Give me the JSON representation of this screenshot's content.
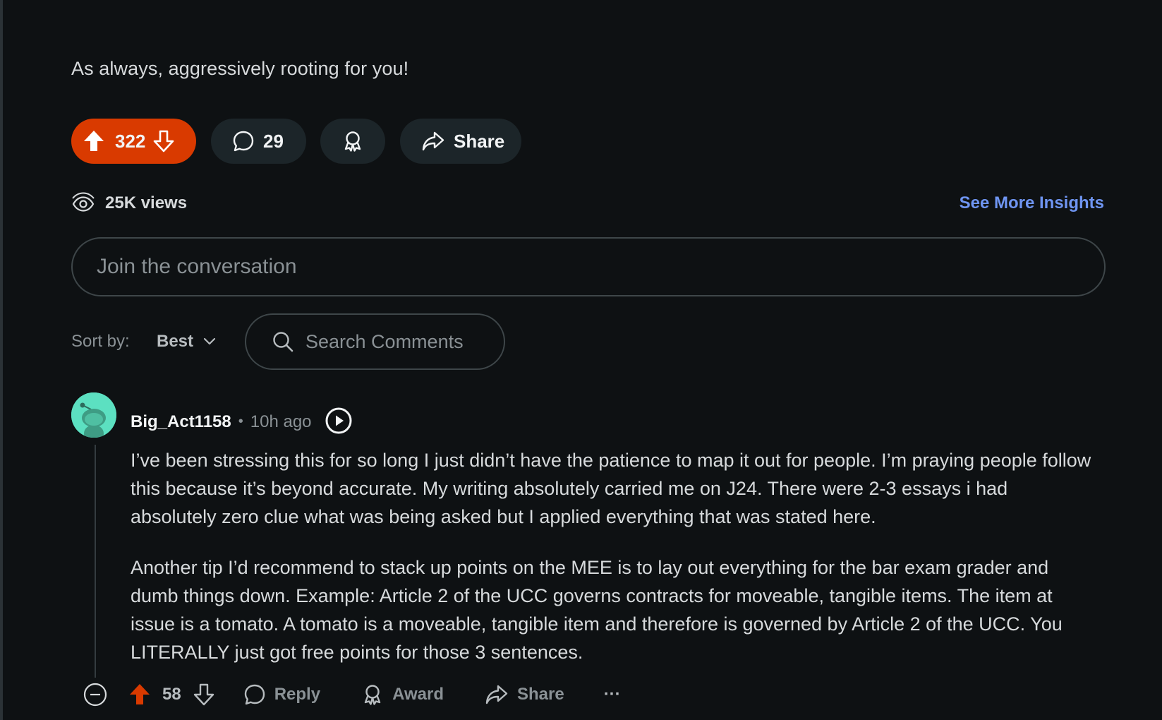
{
  "post": {
    "text": "As always, aggressively rooting for you!",
    "vote_count": "322",
    "comment_count": "29",
    "share_label": "Share",
    "views": "25K views",
    "insights_label": "See More Insights",
    "upvoted": true,
    "accent_color": "#d93a00"
  },
  "composer": {
    "placeholder": "Join the conversation"
  },
  "sort": {
    "label": "Sort by:",
    "value": "Best",
    "search_placeholder": "Search Comments"
  },
  "comment": {
    "author": "Big_Act1158",
    "separator": "•",
    "time": "10h ago",
    "paragraphs": [
      "I’ve been stressing this for so long I just didn’t have the patience to map it out for people. I’m praying people follow this because it’s beyond accurate. My writing absolutely carried me on J24. There were 2-3 essays i had absolutely zero clue what was being asked but I applied everything that was stated here.",
      "Another tip I’d recommend to stack up points on the MEE is to lay out everything for the bar exam grader and dumb things down. Example: Article 2 of the UCC governs contracts for moveable, tangible items. The item at issue is a tomato. A tomato is a moveable, tangible item and therefore is governed by Article 2 of the UCC. You LITERALLY just got free points for those 3 sentences."
    ],
    "vote_count": "58",
    "reply_label": "Reply",
    "award_label": "Award",
    "share_label": "Share",
    "more_label": "···",
    "avatar_color": "#5ce0c1"
  }
}
